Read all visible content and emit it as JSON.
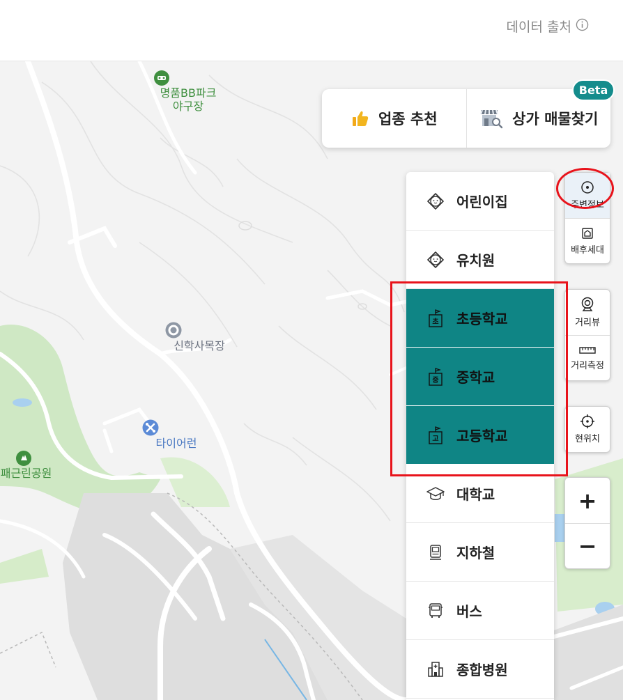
{
  "header": {
    "data_source_label": "데이터 출처",
    "info_icon": "info-icon"
  },
  "map": {
    "pois": [
      {
        "label_line1": "명품BB파크",
        "label_line2": "야구장",
        "icon": "baseball-field-icon",
        "color": "#3f8f3f"
      },
      {
        "label": "신학사목장",
        "icon": "place-pin-icon",
        "color": "#6b7280"
      },
      {
        "label": "타이어런",
        "icon": "repair-shop-icon",
        "color": "#4a78c2"
      },
      {
        "label": "실패근린공원",
        "icon": "park-tree-icon",
        "color": "#3f8f3f"
      }
    ]
  },
  "business_panel": {
    "recommend_label": "업종 추천",
    "store_label": "상가 매물찾기",
    "beta_badge": "Beta"
  },
  "facilities": [
    {
      "label": "어린이집",
      "icon": "baby-face-icon",
      "active": false
    },
    {
      "label": "유치원",
      "icon": "baby-face-icon",
      "active": false
    },
    {
      "label": "초등학교",
      "icon": "elementary-school-icon",
      "badge": "초",
      "active": true
    },
    {
      "label": "중학교",
      "icon": "middle-school-icon",
      "badge": "중",
      "active": true
    },
    {
      "label": "고등학교",
      "icon": "high-school-icon",
      "badge": "고",
      "active": true
    },
    {
      "label": "대학교",
      "icon": "graduation-cap-icon",
      "active": false
    },
    {
      "label": "지하철",
      "icon": "subway-icon",
      "active": false
    },
    {
      "label": "버스",
      "icon": "bus-icon",
      "active": false
    },
    {
      "label": "종합병원",
      "icon": "hospital-icon",
      "active": false
    }
  ],
  "tools": {
    "nearby_info": "주변정보",
    "household": "배후세대",
    "street_view": "거리뷰",
    "distance": "거리측정",
    "my_location": "현위치",
    "zoom_in": "+",
    "zoom_out": "−"
  },
  "colors": {
    "accent_teal": "#0f8585",
    "highlight_red": "#e8131b",
    "park_green": "#cfe8c4",
    "road_white": "#ffffff",
    "map_bg": "#f2f2f2"
  }
}
